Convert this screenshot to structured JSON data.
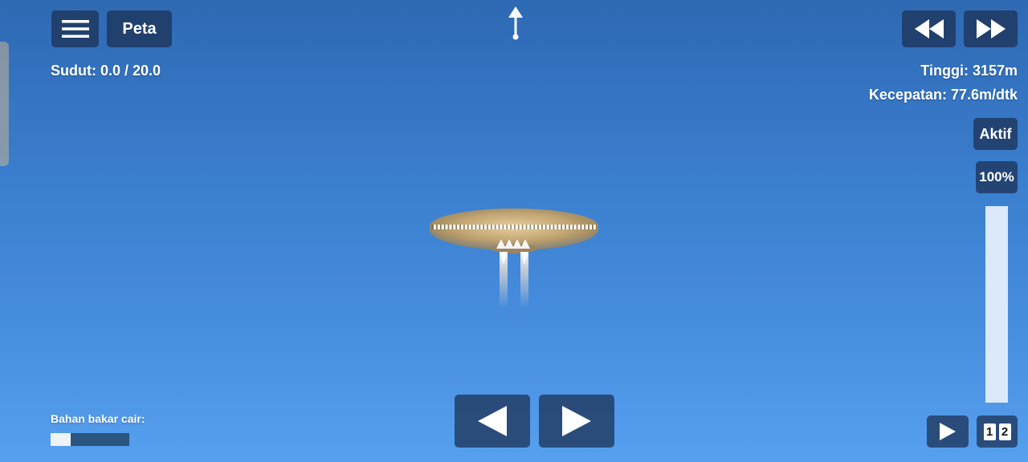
{
  "top_bar": {
    "map_label": "Peta",
    "angle_label": "Sudut: 0.0 / 20.0"
  },
  "flight_info": {
    "altitude": "Tinggi: 3157m",
    "speed": "Kecepatan: 77.6m/dtk"
  },
  "controls": {
    "active_label": "Aktif",
    "throttle_label": "100%",
    "throttle_level": 1.0
  },
  "fuel": {
    "label": "Bahan bakar cair:",
    "level": 0.25
  },
  "stages": [
    "1",
    "2"
  ],
  "icons": {
    "menu": "hamburger-menu-icon",
    "rewind": "rewind-icon",
    "fast_forward": "fast-forward-icon",
    "rotate_left": "arrow-left-icon",
    "rotate_right": "arrow-right-icon",
    "stage": "play-icon",
    "prograde": "up-arrow-marker-icon"
  },
  "colors": {
    "sky_top": "#2e69b3",
    "sky_bottom": "#56a0ef",
    "button_bg": "#1c3255",
    "craft_hull": "#c9b383"
  }
}
